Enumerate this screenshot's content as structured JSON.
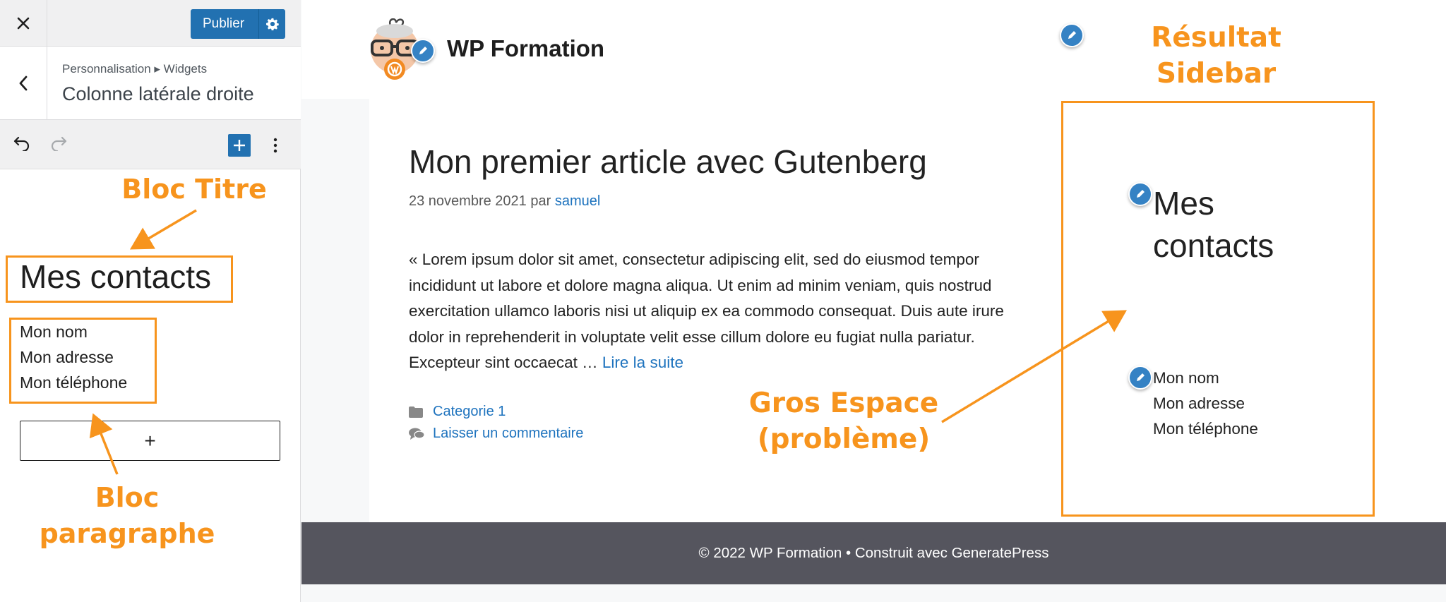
{
  "customizer": {
    "close_icon": "close-icon",
    "publish_label": "Publier",
    "publish_settings_icon": "gear-icon",
    "back_icon": "chevron-left-icon",
    "breadcrumb": "Personnalisation ▸ Widgets",
    "section_title": "Colonne latérale droite",
    "toolbar": {
      "undo_icon": "undo-icon",
      "redo_icon": "redo-icon",
      "add_icon": "plus-icon",
      "options_icon": "more-vertical-icon"
    },
    "blocks": {
      "heading": "Mes contacts",
      "paragraph_lines": [
        "Mon nom",
        "Mon adresse",
        "Mon téléphone"
      ],
      "add_block_label": "+"
    }
  },
  "site": {
    "title": "WP Formation",
    "post": {
      "title": "Mon premier article avec Gutenberg",
      "date": "23 novembre 2021",
      "by": "par",
      "author": "samuel",
      "excerpt": "« Lorem ipsum dolor sit amet, consectetur adipiscing elit, sed do eiusmod tempor incididunt ut labore et dolore magna aliqua. Ut enim ad minim veniam, quis nostrud exercitation ullamco laboris nisi ut aliquip ex ea commodo consequat. Duis aute irure dolor in reprehenderit in voluptate velit esse cillum dolore eu fugiat nulla pariatur. Excepteur sint occaecat …",
      "read_more": "Lire la suite",
      "category": "Categorie 1",
      "comment_link": "Laisser un commentaire"
    },
    "sidebar": {
      "heading_line1": "Mes",
      "heading_line2": "contacts",
      "paragraph_lines": [
        "Mon nom",
        "Mon adresse",
        "Mon téléphone"
      ]
    },
    "footer": "© 2022 WP Formation • Construit avec GeneratePress"
  },
  "annotations": {
    "bloc_titre": "Bloc Titre",
    "bloc_paragraphe_l1": "Bloc",
    "bloc_paragraphe_l2": "paragraphe",
    "resultat_l1": "Résultat",
    "resultat_l2": "Sidebar",
    "espace_l1": "Gros Espace",
    "espace_l2": "(problème)",
    "color": "#f7941d"
  },
  "colors": {
    "accent": "#2271b1",
    "link": "#1e73be",
    "footer": "#55555e",
    "edit_pencil": "#3582c4"
  }
}
